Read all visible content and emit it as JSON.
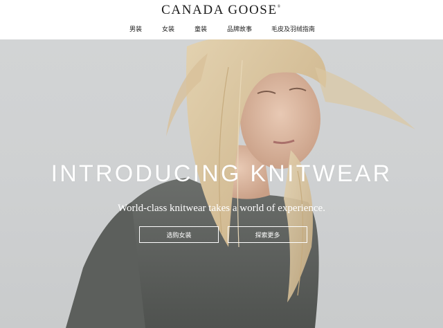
{
  "brand": {
    "name": "CANADA GOOSE",
    "mark": "®"
  },
  "nav": {
    "items": [
      {
        "label": "男装"
      },
      {
        "label": "女装"
      },
      {
        "label": "童装"
      },
      {
        "label": "品牌故事"
      },
      {
        "label": "毛皮及羽绒指南"
      }
    ]
  },
  "hero": {
    "headline": "INTRODUCING KNITWEAR",
    "tagline": "World-class knitwear takes a world of experience.",
    "buttons": {
      "shop_label": "选购女装",
      "explore_label": "探索更多"
    }
  }
}
